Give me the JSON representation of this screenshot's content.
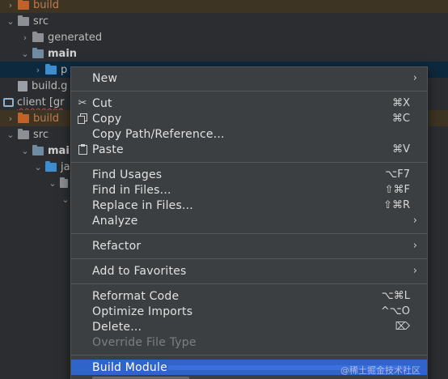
{
  "tree": {
    "rows": [
      {
        "label": "build"
      },
      {
        "label": "src"
      },
      {
        "label": "generated"
      },
      {
        "label": "main"
      },
      {
        "label": "p"
      },
      {
        "label": "build.g"
      },
      {
        "label": "client [gr"
      },
      {
        "label": "build"
      },
      {
        "label": "src"
      },
      {
        "label": "mai"
      },
      {
        "label": "ja"
      }
    ]
  },
  "menu": {
    "items": [
      {
        "label": "New",
        "shortcut": "",
        "submenu": true
      },
      {
        "label": "Cut",
        "shortcut": "⌘X",
        "icon": "scissors-icon"
      },
      {
        "label": "Copy",
        "shortcut": "⌘C",
        "icon": "copy-icon"
      },
      {
        "label": "Copy Path/Reference...",
        "shortcut": ""
      },
      {
        "label": "Paste",
        "shortcut": "⌘V",
        "icon": "clipboard-icon"
      },
      {
        "label": "Find Usages",
        "shortcut": "⌥F7"
      },
      {
        "label": "Find in Files...",
        "shortcut": "⇧⌘F"
      },
      {
        "label": "Replace in Files...",
        "shortcut": "⇧⌘R"
      },
      {
        "label": "Analyze",
        "shortcut": "",
        "submenu": true
      },
      {
        "label": "Refactor",
        "shortcut": "",
        "submenu": true
      },
      {
        "label": "Add to Favorites",
        "shortcut": "",
        "submenu": true
      },
      {
        "label": "Reformat Code",
        "shortcut": "⌥⌘L"
      },
      {
        "label": "Optimize Imports",
        "shortcut": "^⌥O"
      },
      {
        "label": "Delete...",
        "shortcut": "⌦"
      },
      {
        "label": "Override File Type",
        "shortcut": "",
        "disabled": true
      },
      {
        "label": "Build Module",
        "shortcut": "",
        "highlighted": true
      }
    ],
    "submenu_arrow": "›",
    "highlight_color": "#2f65ca",
    "background_color": "#3c3f41"
  },
  "watermark": "@稀土掘金技术社区"
}
